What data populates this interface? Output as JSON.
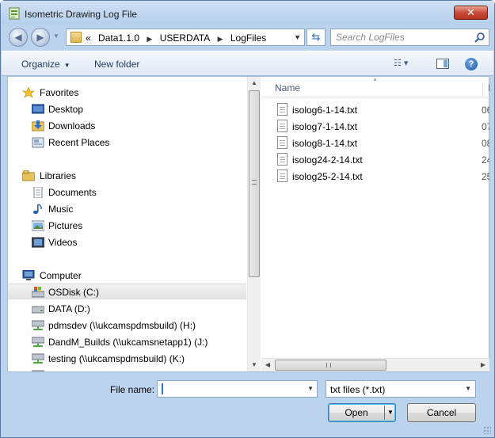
{
  "window": {
    "title": "Isometric Drawing Log File",
    "close_label": "✕"
  },
  "navbar": {
    "back_icon": "◀",
    "forward_icon": "▶",
    "breadcrumb_lead": "«",
    "breadcrumbs": [
      "Data1.1.0",
      "USERDATA",
      "LogFiles"
    ],
    "breadcrumb_separator": "▶",
    "search_placeholder": "Search LogFiles",
    "refresh_icon": "⇆"
  },
  "toolbar": {
    "organize_label": "Organize",
    "new_folder_label": "New folder",
    "views_label": "☷ ▾",
    "help_label": "?"
  },
  "nav_pane": {
    "favorites": {
      "label": "Favorites",
      "items": [
        "Desktop",
        "Downloads",
        "Recent Places"
      ]
    },
    "libraries": {
      "label": "Libraries",
      "items": [
        "Documents",
        "Music",
        "Pictures",
        "Videos"
      ]
    },
    "computer": {
      "label": "Computer",
      "items": [
        "OSDisk (C:)",
        "DATA (D:)",
        "pdmsdev (\\\\ukcamspdmsbuild) (H:)",
        "DandM_Builds (\\\\ukcamsnetapp1) (J:)",
        "testing (\\\\ukcamspdmsbuild) (K:)"
      ],
      "selected_index": 0
    }
  },
  "file_list": {
    "columns": [
      "Name",
      "Da"
    ],
    "files": [
      {
        "name": "isolog6-1-14.txt",
        "date": "06"
      },
      {
        "name": "isolog7-1-14.txt",
        "date": "07"
      },
      {
        "name": "isolog8-1-14.txt",
        "date": "08"
      },
      {
        "name": "isolog24-2-14.txt",
        "date": "24"
      },
      {
        "name": "isolog25-2-14.txt",
        "date": "25"
      }
    ]
  },
  "footer": {
    "file_name_label": "File name:",
    "file_name_value": "",
    "file_type_value": "txt files (*.txt)",
    "open_label": "Open",
    "cancel_label": "Cancel"
  },
  "colors": {
    "chrome": "#bcd3ee",
    "close": "#c84a38",
    "selection": "#e3e3e3"
  }
}
